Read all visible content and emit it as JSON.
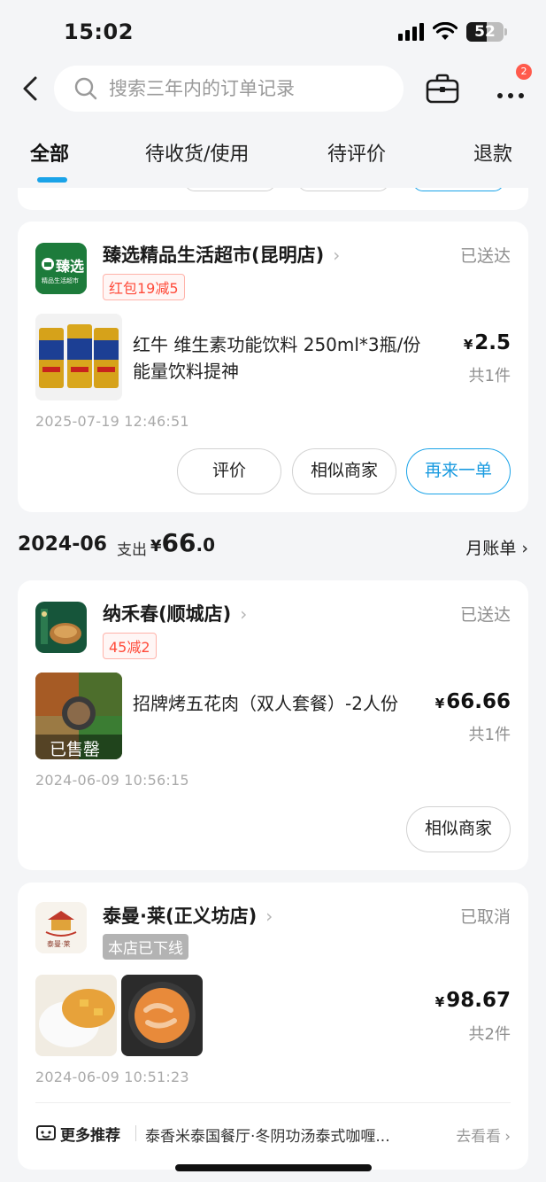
{
  "status_bar": {
    "time": "15:02",
    "battery": "52"
  },
  "search": {
    "placeholder": "搜索三年内的订单记录"
  },
  "header": {
    "badge_count": "2"
  },
  "tabs": [
    {
      "label": "全部",
      "active": true
    },
    {
      "label": "待收货/使用",
      "active": false
    },
    {
      "label": "待评价",
      "active": false
    },
    {
      "label": "退款",
      "active": false
    }
  ],
  "orders": [
    {
      "shop_name": "臻选精品生活超市(昆明店)",
      "status": "已送达",
      "tag": "红包19减5",
      "product_name": "红牛 维生素功能饮料 250ml*3瓶/份 能量饮料提神",
      "price_symbol": "¥",
      "price": "2.5",
      "qty": "共1件",
      "time": "2025-07-19 12:46:51",
      "logo_text": "臻选",
      "logo_sub": "精品生活超市",
      "buttons": [
        "评价",
        "相似商家",
        "再来一单"
      ]
    },
    {
      "shop_name": "纳禾春(顺城店)",
      "status": "已送达",
      "tag": "45减2",
      "product_name": "招牌烤五花肉（双人套餐）-2人份",
      "sold_out": "已售罄",
      "price_symbol": "¥",
      "price": "66.66",
      "qty": "共1件",
      "time": "2024-06-09 10:56:15",
      "buttons": [
        "相似商家"
      ]
    },
    {
      "shop_name": "泰曼·莱(正义坊店)",
      "status": "已取消",
      "tag": "本店已下线",
      "price_symbol": "¥",
      "price": "98.67",
      "qty": "共2件",
      "time": "2024-06-09 10:51:23",
      "logo_sub": "泰曼·莱"
    }
  ],
  "month_summary": {
    "month": "2024-06",
    "spend_label": "支出",
    "spend_symbol": "¥",
    "spend_int": "66",
    "spend_dec": ".0",
    "bill_link": "月账单"
  },
  "recommend": {
    "title": "更多推荐",
    "text": "泰香米泰国餐厅·冬阴功汤泰式咖喱...",
    "link": "去看看"
  },
  "colors": {
    "accent": "#1aa3e8",
    "discount_red": "#ff4b3a",
    "badge_red": "#ff5a4c"
  }
}
